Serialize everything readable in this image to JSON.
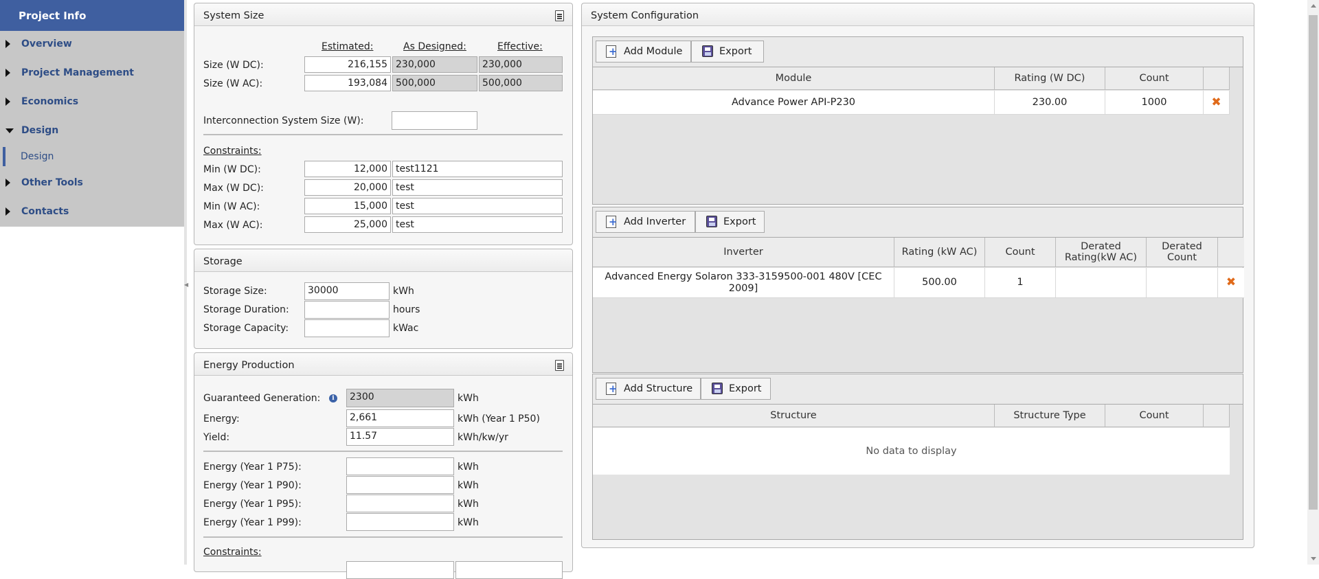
{
  "sidebar": {
    "title": "Project Info",
    "items": [
      {
        "label": "Overview"
      },
      {
        "label": "Project Management"
      },
      {
        "label": "Economics"
      },
      {
        "label": "Design"
      },
      {
        "label": "Other Tools"
      },
      {
        "label": "Contacts"
      }
    ],
    "subitem": "Design"
  },
  "system_size": {
    "title": "System Size",
    "col_estimated": "Estimated:",
    "col_designed": "As Designed:",
    "col_effective": "Effective:",
    "rows": [
      {
        "label": "Size (W DC):",
        "estimated": "216,155",
        "designed": "230,000",
        "effective": "230,000"
      },
      {
        "label": "Size (W AC):",
        "estimated": "193,084",
        "designed": "500,000",
        "effective": "500,000"
      }
    ],
    "interconnection_label": "Interconnection System Size (W):",
    "interconnection_value": "",
    "constraints_label": "Constraints:",
    "constraints": [
      {
        "label": "Min (W DC):",
        "value": "12,000",
        "note": "test1121"
      },
      {
        "label": "Max (W DC):",
        "value": "20,000",
        "note": "test"
      },
      {
        "label": "Min (W AC):",
        "value": "15,000",
        "note": "test"
      },
      {
        "label": "Max (W AC):",
        "value": "25,000",
        "note": "test"
      }
    ]
  },
  "storage": {
    "title": "Storage",
    "size_label": "Storage Size:",
    "size_value": "30000",
    "size_unit": "kWh",
    "duration_label": "Storage Duration:",
    "duration_value": "",
    "duration_unit": "hours",
    "capacity_label": "Storage Capacity:",
    "capacity_value": "",
    "capacity_unit": "kWac"
  },
  "energy": {
    "title": "Energy Production",
    "guaranteed_label": "Guaranteed Generation:",
    "guaranteed_value": "2300",
    "guaranteed_unit": "kWh",
    "energy_label": "Energy:",
    "energy_value": "2,661",
    "energy_unit": "kWh (Year 1 P50)",
    "yield_label": "Yield:",
    "yield_value": "11.57",
    "yield_unit": "kWh/kw/yr",
    "p_rows": [
      {
        "label": "Energy (Year 1 P75):",
        "value": "",
        "unit": "kWh"
      },
      {
        "label": "Energy (Year 1 P90):",
        "value": "",
        "unit": "kWh"
      },
      {
        "label": "Energy (Year 1 P95):",
        "value": "",
        "unit": "kWh"
      },
      {
        "label": "Energy (Year 1 P99):",
        "value": "",
        "unit": "kWh"
      }
    ],
    "constraints_label": "Constraints:"
  },
  "config": {
    "title": "System Configuration",
    "module": {
      "add_label": "Add Module",
      "export_label": "Export",
      "headers": [
        "Module",
        "Rating (W DC)",
        "Count"
      ],
      "rows": [
        {
          "name": "Advance Power API-P230",
          "rating": "230.00",
          "count": "1000"
        }
      ]
    },
    "inverter": {
      "add_label": "Add Inverter",
      "export_label": "Export",
      "headers": [
        "Inverter",
        "Rating (kW AC)",
        "Count",
        "Derated Rating(kW AC)",
        "Derated Count"
      ],
      "rows": [
        {
          "name": "Advanced Energy Solaron 333-3159500-001 480V [CEC 2009]",
          "rating": "500.00",
          "count": "1",
          "derated_rating": "",
          "derated_count": ""
        }
      ]
    },
    "structure": {
      "add_label": "Add Structure",
      "export_label": "Export",
      "headers": [
        "Structure",
        "Structure Type",
        "Count"
      ],
      "empty_text": "No data to display"
    }
  },
  "colors": {
    "nav_header": "#3f5fa0",
    "nav_text": "#2e4d86",
    "sidebar_bg": "#c7c7c7",
    "delete_icon": "#e06a1a"
  }
}
